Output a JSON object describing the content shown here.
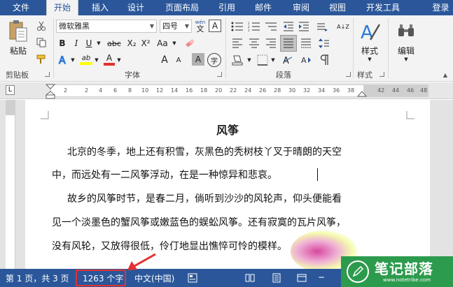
{
  "tabs": [
    {
      "label": "文件"
    },
    {
      "label": "开始"
    },
    {
      "label": "插入"
    },
    {
      "label": "设计"
    },
    {
      "label": "页面布局"
    },
    {
      "label": "引用"
    },
    {
      "label": "邮件"
    },
    {
      "label": "审阅"
    },
    {
      "label": "视图"
    },
    {
      "label": "开发工具"
    },
    {
      "label": "登录"
    }
  ],
  "ribbon": {
    "clipboard": {
      "label": "剪贴板",
      "paste_label": "粘贴"
    },
    "font": {
      "label": "字体",
      "font_name": "微软雅黑",
      "font_size": "四号",
      "wen_label": "wén",
      "wen_char": "文",
      "border_char": "A",
      "bold": "B",
      "italic": "I",
      "underline": "U",
      "strike": "abc",
      "subscript": "X₂",
      "superscript": "X²",
      "case": "Aa",
      "grow": "A",
      "shrink": "A",
      "shade": "A",
      "circle_char": "字",
      "highlight": "ab",
      "color_a": "A",
      "text_effect": "A"
    },
    "paragraph": {
      "label": "段落",
      "sort": "A↓Z"
    },
    "styles": {
      "label": "样式",
      "style_label": "样式"
    },
    "editing": {
      "label": "编辑"
    }
  },
  "ruler": {
    "corner": "L",
    "ticks": [
      "2",
      "2",
      "4",
      "6",
      "8",
      "10",
      "12",
      "14",
      "16",
      "18",
      "20",
      "22",
      "24",
      "26",
      "28",
      "30",
      "32",
      "34",
      "36",
      "38",
      "42",
      "44",
      "46",
      "48"
    ]
  },
  "document": {
    "title": "风筝",
    "lines": [
      "北京的冬季，地上还有积雪，灰黑色的秃树枝丫叉于晴朗的天空",
      "中，而远处有一二风筝浮动，在是一种惊异和悲哀。",
      "故乡的风筝时节，是春二月，倘听到沙沙的风轮声，仰头便能看",
      "见一个淡墨色的蟹风筝或嫩蓝色的蜈蚣风筝。还有寂寞的瓦片风筝，",
      "没有风轮，又放得很低，伶仃地显出憔悴可怜的模样。"
    ]
  },
  "status": {
    "page_info": "第 1 页，共 3 页",
    "word_count": "1263 个字",
    "language": "中文(中国)"
  },
  "watermark": {
    "title": "笔记部落",
    "url": "www.notetribe.com"
  },
  "colors": {
    "word_blue": "#2b579a",
    "highlight_red": "#e2312f",
    "watermark_green": "#2d9b4d"
  }
}
